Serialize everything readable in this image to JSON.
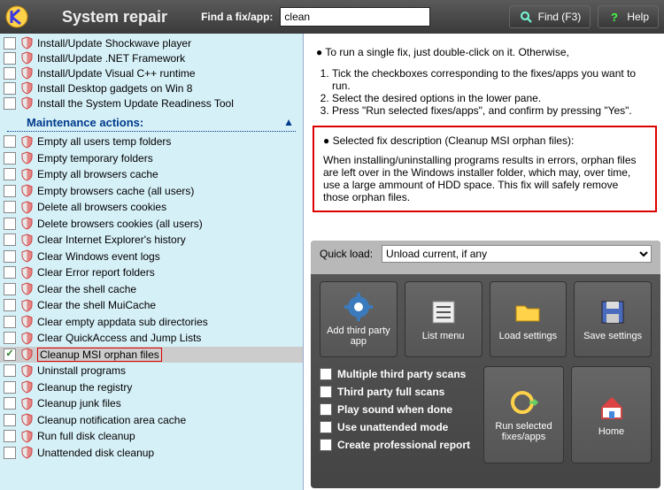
{
  "header": {
    "title": "System repair",
    "find_label": "Find a fix/app:",
    "search_value": "clean",
    "find_button": "Find (F3)",
    "help_button": "Help"
  },
  "left_panel": {
    "top_items": [
      {
        "label": "Install/Update Shockwave player",
        "checked": false
      },
      {
        "label": "Install/Update .NET Framework",
        "checked": false
      },
      {
        "label": "Install/Update Visual C++ runtime",
        "checked": false
      },
      {
        "label": "Install Desktop gadgets on Win 8",
        "checked": false
      },
      {
        "label": "Install the System Update Readiness Tool",
        "checked": false
      }
    ],
    "section_title": "Maintenance actions:",
    "items": [
      {
        "label": "Empty all users temp folders",
        "checked": false
      },
      {
        "label": "Empty temporary folders",
        "checked": false
      },
      {
        "label": "Empty all browsers cache",
        "checked": false
      },
      {
        "label": "Empty browsers cache (all users)",
        "checked": false
      },
      {
        "label": "Delete all browsers cookies",
        "checked": false
      },
      {
        "label": "Delete browsers cookies (all users)",
        "checked": false
      },
      {
        "label": "Clear Internet Explorer's history",
        "checked": false
      },
      {
        "label": "Clear Windows event logs",
        "checked": false
      },
      {
        "label": "Clear Error report folders",
        "checked": false
      },
      {
        "label": "Clear the shell cache",
        "checked": false
      },
      {
        "label": "Clear the shell MuiCache",
        "checked": false
      },
      {
        "label": "Clear empty appdata sub directories",
        "checked": false
      },
      {
        "label": "Clear QuickAccess and Jump Lists",
        "checked": false
      },
      {
        "label": "Cleanup MSI orphan files",
        "checked": true,
        "highlight": true
      },
      {
        "label": "Uninstall programs",
        "checked": false
      },
      {
        "label": "Cleanup the registry",
        "checked": false
      },
      {
        "label": "Cleanup junk files",
        "checked": false
      },
      {
        "label": "Cleanup notification area cache",
        "checked": false
      },
      {
        "label": "Run full disk cleanup",
        "checked": false
      },
      {
        "label": "Unattended disk cleanup",
        "checked": false
      }
    ]
  },
  "instructions": {
    "lead": "● To run a single fix, just double-click on it. Otherwise,",
    "steps": [
      "Tick the checkboxes corresponding to the fixes/apps you want to run.",
      "Select the desired options in the lower pane.",
      "Press \"Run selected fixes/apps\", and confirm by pressing \"Yes\"."
    ]
  },
  "description": {
    "title": "● Selected fix description (Cleanup MSI orphan files):",
    "body": "When installing/uninstalling programs results in errors, orphan files are left over in the Windows installer folder, which may, over time, use a large ammount of HDD space. This fix will safely remove those orphan files."
  },
  "bottom": {
    "quick_load_label": "Quick load:",
    "quick_load_value": "Unload current, if any",
    "buttons1": [
      {
        "label": "Add third party app",
        "icon": "gear"
      },
      {
        "label": "List menu",
        "icon": "list"
      },
      {
        "label": "Load settings",
        "icon": "folder"
      },
      {
        "label": "Save settings",
        "icon": "save"
      }
    ],
    "checks": [
      "Multiple third party scans",
      "Third party full scans",
      "Play sound when done",
      "Use unattended mode",
      "Create professional report"
    ],
    "buttons2": [
      {
        "label": "Run selected fixes/apps",
        "icon": "run"
      },
      {
        "label": "Home",
        "icon": "home"
      }
    ]
  }
}
